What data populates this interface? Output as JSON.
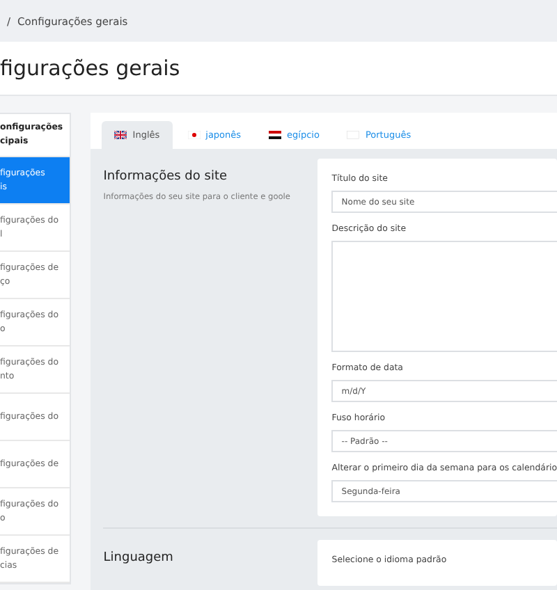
{
  "breadcrumb": {
    "separator": "/",
    "current": "Configurações gerais"
  },
  "page_title": "figurações gerais",
  "sidebar": {
    "items": [
      {
        "lines": [
          "onfigurações",
          "cipais"
        ],
        "kind": "header",
        "selected": false
      },
      {
        "lines": [
          "figurações",
          "is"
        ],
        "kind": "item",
        "selected": true
      },
      {
        "lines": [
          "figurações do",
          "l"
        ],
        "kind": "item",
        "selected": false
      },
      {
        "lines": [
          "figurações de",
          "ço"
        ],
        "kind": "item",
        "selected": false
      },
      {
        "lines": [
          "figurações do",
          "o"
        ],
        "kind": "item",
        "selected": false
      },
      {
        "lines": [
          "figurações do",
          "nto"
        ],
        "kind": "item",
        "selected": false
      },
      {
        "lines": [
          "figurações do"
        ],
        "kind": "item",
        "selected": false
      },
      {
        "lines": [
          "figurações de"
        ],
        "kind": "item",
        "selected": false
      },
      {
        "lines": [
          "figurações do",
          "o"
        ],
        "kind": "item",
        "selected": false
      },
      {
        "lines": [
          "figurações de",
          "cias"
        ],
        "kind": "item",
        "selected": false
      }
    ]
  },
  "tabs": [
    {
      "label": "Inglês",
      "kind": "uk",
      "selected": true
    },
    {
      "label": "japonês",
      "kind": "jp",
      "selected": false
    },
    {
      "label": "egípcio",
      "kind": "eg",
      "selected": false
    },
    {
      "label": "Português",
      "kind": "blank",
      "selected": false
    }
  ],
  "sections": [
    {
      "title": "Informações do site",
      "description": "Informações do seu site para o cliente e goole",
      "fields": [
        {
          "label": "Título do site",
          "kind": "input",
          "placeholder": "Nome do seu site"
        },
        {
          "label": "Descrição do site",
          "kind": "textarea"
        },
        {
          "label": "Formato de data",
          "kind": "input",
          "value": "m/d/Y"
        },
        {
          "label": "Fuso horário",
          "kind": "select",
          "value": "-- Padrão --"
        },
        {
          "label": "Alterar o primeiro dia da semana para os calendário",
          "kind": "select",
          "value": "Segunda-feira"
        }
      ]
    },
    {
      "title": "Linguagem",
      "fields": [
        {
          "label": "Selecione o idioma padrão",
          "kind": "label"
        }
      ]
    }
  ]
}
